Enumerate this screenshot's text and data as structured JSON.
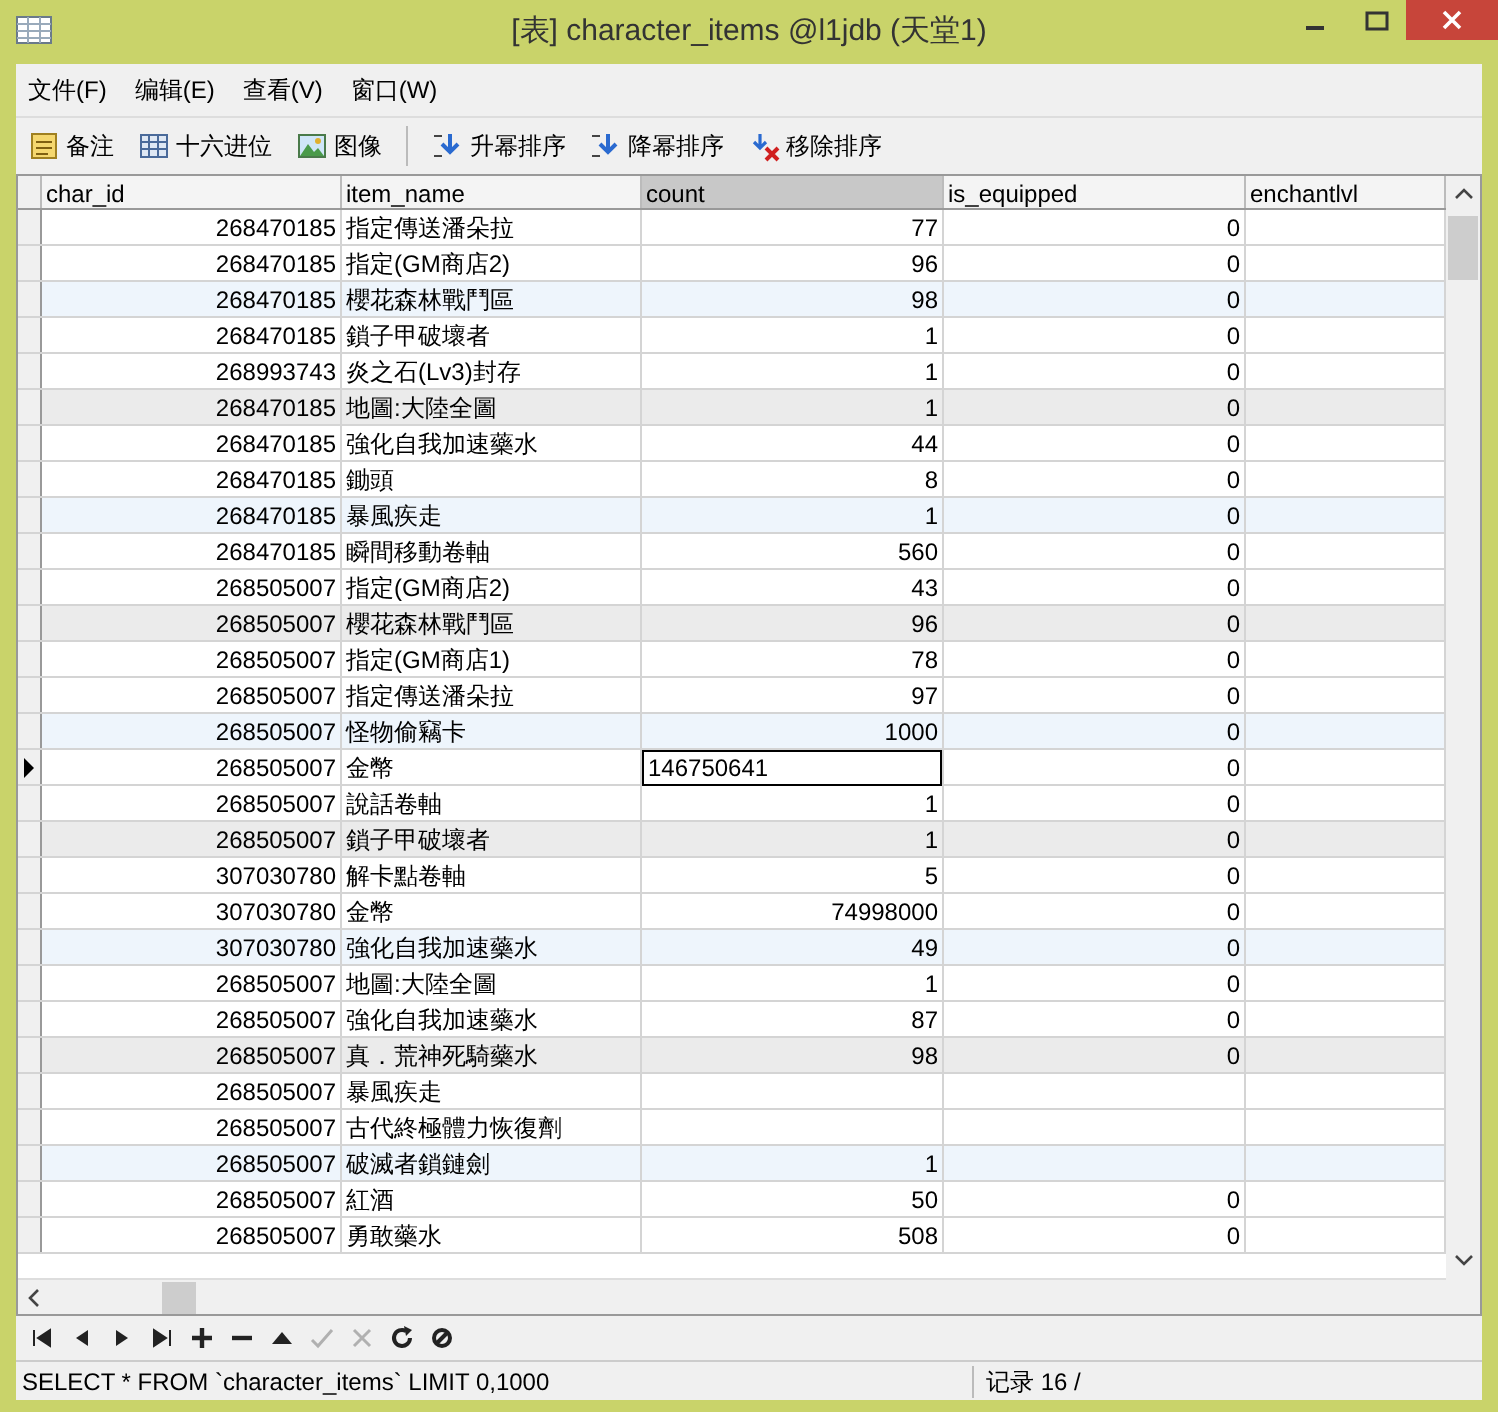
{
  "window": {
    "title": "[表] character_items @l1jdb (天堂1)"
  },
  "menu": [
    "文件(F)",
    "编辑(E)",
    "查看(V)",
    "窗口(W)"
  ],
  "toolbar": [
    {
      "kind": "memo",
      "label": "备注"
    },
    {
      "kind": "hex",
      "label": "十六进位"
    },
    {
      "kind": "image",
      "label": "图像"
    },
    {
      "kind": "asc",
      "label": "升幂排序"
    },
    {
      "kind": "desc",
      "label": "降幂排序"
    },
    {
      "kind": "remove",
      "label": "移除排序"
    }
  ],
  "table": {
    "columns": [
      {
        "label": "char_id",
        "kind": "number",
        "selected": false
      },
      {
        "label": "item_name",
        "kind": "text",
        "selected": false
      },
      {
        "label": "count",
        "kind": "number",
        "selected": true
      },
      {
        "label": "is_equipped",
        "kind": "number",
        "selected": false
      },
      {
        "label": "enchantlvl",
        "selected": false
      }
    ],
    "rows": [
      {
        "selected": false,
        "cells": [
          "268470185",
          "指定傳送潘朵拉",
          "77",
          "0"
        ]
      },
      {
        "selected": false,
        "cells": [
          "268470185",
          "指定(GM商店2)",
          "96",
          "0"
        ]
      },
      {
        "color": "#eef5fc",
        "selected": false,
        "cells": [
          "268470185",
          "櫻花森林戰鬥區",
          "98",
          "0"
        ]
      },
      {
        "selected": false,
        "cells": [
          "268470185",
          "鎖子甲破壞者",
          "1",
          "0"
        ]
      },
      {
        "selected": false,
        "cells": [
          "268993743",
          "炎之石(Lv3)封存",
          "1",
          "0"
        ]
      },
      {
        "color": "#ebebeb",
        "selected": false,
        "cells": [
          "268470185",
          "地圖:大陸全圖",
          "1",
          "0"
        ]
      },
      {
        "selected": false,
        "cells": [
          "268470185",
          "強化自我加速藥水",
          "44",
          "0"
        ]
      },
      {
        "selected": false,
        "cells": [
          "268470185",
          "鋤頭",
          "8",
          "0"
        ]
      },
      {
        "color": "#eef5fc",
        "selected": false,
        "cells": [
          "268470185",
          "暴風疾走",
          "1",
          "0"
        ]
      },
      {
        "selected": false,
        "cells": [
          "268470185",
          "瞬間移動卷軸",
          "560",
          "0"
        ]
      },
      {
        "selected": false,
        "cells": [
          "268505007",
          "指定(GM商店2)",
          "43",
          "0"
        ]
      },
      {
        "color": "#ebebeb",
        "selected": false,
        "cells": [
          "268505007",
          "櫻花森林戰鬥區",
          "96",
          "0"
        ]
      },
      {
        "selected": false,
        "cells": [
          "268505007",
          "指定(GM商店1)",
          "78",
          "0"
        ]
      },
      {
        "selected": false,
        "cells": [
          "268505007",
          "指定傳送潘朵拉",
          "97",
          "0"
        ]
      },
      {
        "color": "#eef5fc",
        "selected": false,
        "cells": [
          "268505007",
          "怪物偷竊卡",
          "1000",
          "0"
        ]
      },
      {
        "selected": true,
        "cells": [
          "268505007",
          "金幣",
          "146750641",
          "0"
        ]
      },
      {
        "selected": false,
        "cells": [
          "268505007",
          "說話卷軸",
          "1",
          "0"
        ]
      },
      {
        "color": "#ebebeb",
        "selected": false,
        "cells": [
          "268505007",
          "鎖子甲破壞者",
          "1",
          "0"
        ]
      },
      {
        "selected": false,
        "cells": [
          "307030780",
          "解卡點卷軸",
          "5",
          "0"
        ]
      },
      {
        "selected": false,
        "cells": [
          "307030780",
          "金幣",
          "74998000",
          "0"
        ]
      },
      {
        "color": "#eef5fc",
        "selected": false,
        "cells": [
          "307030780",
          "強化自我加速藥水",
          "49",
          "0"
        ]
      },
      {
        "selected": false,
        "cells": [
          "268505007",
          "地圖:大陸全圖",
          "1",
          "0"
        ]
      },
      {
        "selected": false,
        "cells": [
          "268505007",
          "強化自我加速藥水",
          "87",
          "0"
        ]
      },
      {
        "color": "#ebebeb",
        "selected": false,
        "cells": [
          "268505007",
          "真．荒神死騎藥水",
          "98",
          "0"
        ]
      },
      {
        "selected": false,
        "cells": [
          "268505007",
          "暴風疾走"
        ]
      },
      {
        "selected": false,
        "cells": [
          "268505007",
          "古代終極體力恢復劑"
        ]
      },
      {
        "color": "#eef5fc",
        "selected": false,
        "cells": [
          "268505007",
          "破滅者鎖鏈劍",
          "1"
        ]
      },
      {
        "selected": false,
        "cells": [
          "268505007",
          "紅酒",
          "50",
          "0"
        ]
      },
      {
        "selected": false,
        "cells": [
          "268505007",
          "勇敢藥水",
          "508",
          "0"
        ]
      }
    ]
  },
  "navigator": [
    {
      "kind": "first",
      "disabled": false
    },
    {
      "kind": "prev",
      "disabled": false
    },
    {
      "kind": "next",
      "disabled": false
    },
    {
      "kind": "last",
      "disabled": false
    },
    {
      "kind": "add",
      "disabled": false
    },
    {
      "kind": "delete",
      "disabled": false
    },
    {
      "kind": "up",
      "disabled": false
    },
    {
      "kind": "apply",
      "disabled": true
    },
    {
      "kind": "cancel",
      "disabled": true
    },
    {
      "kind": "refresh",
      "disabled": false
    },
    {
      "kind": "stop",
      "disabled": false
    }
  ],
  "status_bar": {
    "query": "SELECT * FROM `character_items` LIMIT 0,1000",
    "record": "记录 16 /"
  }
}
